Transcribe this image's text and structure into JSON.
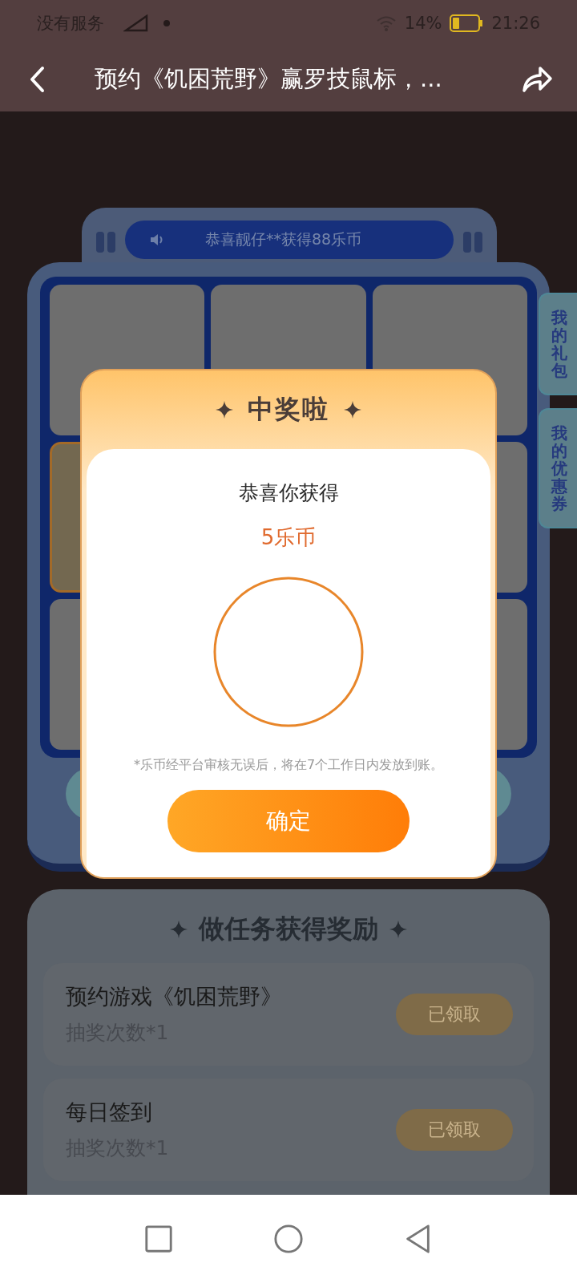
{
  "status_bar": {
    "carrier": "没有服务",
    "battery": "14%",
    "time": "21:26"
  },
  "header": {
    "title": "预约《饥困荒野》赢罗技鼠标，..."
  },
  "lottery": {
    "marquee": "恭喜靓仔**获得88乐币",
    "cells": [
      {
        "selected": false
      },
      {
        "selected": false
      },
      {
        "selected": false
      },
      {
        "selected": true
      },
      {
        "selected": false
      },
      {
        "selected": false
      },
      {
        "selected": false
      }
    ],
    "side_tabs": [
      {
        "label": "我的礼包"
      },
      {
        "label": "我的优惠券"
      }
    ]
  },
  "tasks": {
    "title": "做任务获得奖励",
    "items": [
      {
        "name": "预约游戏《饥困荒野》",
        "reward": "抽奖次数*1",
        "button": "已领取"
      },
      {
        "name": "每日签到",
        "reward": "抽奖次数*1",
        "button": "已领取"
      }
    ]
  },
  "dialog": {
    "title": "中奖啦",
    "subtitle": "恭喜你获得",
    "prize": "5乐币",
    "note": "*乐币经平台审核无误后，将在7个工作日内发放到账。",
    "button": "确定"
  }
}
